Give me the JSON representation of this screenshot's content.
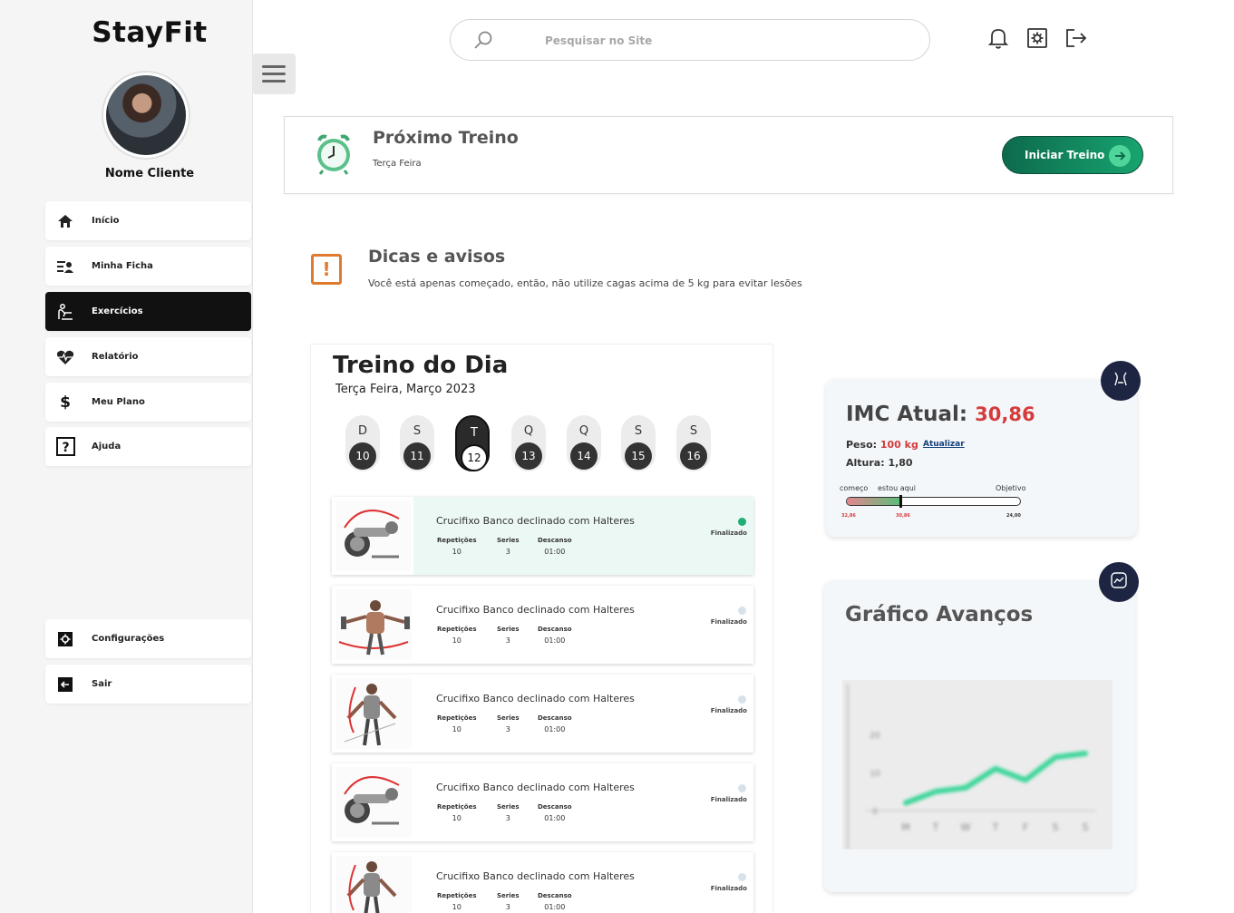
{
  "brand": "StayFit",
  "client_name": "Nome Cliente",
  "sidebar": {
    "items": [
      {
        "label": "Início",
        "icon": "home-icon"
      },
      {
        "label": "Minha Ficha",
        "icon": "profile-list-icon"
      },
      {
        "label": "Exercícios",
        "icon": "exercise-icon",
        "active": true
      },
      {
        "label": "Relatório",
        "icon": "heart-pulse-icon"
      },
      {
        "label": "Meu Plano",
        "icon": "dollar-icon"
      },
      {
        "label": "Ajuda",
        "icon": "help-icon"
      }
    ],
    "bottom_items": [
      {
        "label": "Configurações",
        "icon": "settings-icon"
      },
      {
        "label": "Sair",
        "icon": "logout-icon"
      }
    ]
  },
  "search": {
    "placeholder": "Pesquisar no Site"
  },
  "next_workout": {
    "title": "Próximo Treino",
    "day": "Terça Feira",
    "button": "Iniciar Treino"
  },
  "tips": {
    "title": "Dicas e avisos",
    "text": "Você está apenas começado, então, não utilize cagas acima de 5 kg para evitar lesões"
  },
  "workout": {
    "title": "Treino do Dia",
    "date": "Terça Feira, Março 2023",
    "days": [
      {
        "letter": "D",
        "num": "10"
      },
      {
        "letter": "S",
        "num": "11"
      },
      {
        "letter": "T",
        "num": "12",
        "selected": true
      },
      {
        "letter": "Q",
        "num": "13"
      },
      {
        "letter": "Q",
        "num": "14"
      },
      {
        "letter": "S",
        "num": "15"
      },
      {
        "letter": "S",
        "num": "16"
      }
    ],
    "headers": {
      "reps": "Repetições",
      "series": "Series",
      "rest": "Descanso"
    },
    "exercises": [
      {
        "name": "Crucifixo Banco declinado com Halteres",
        "reps": "10",
        "series": "3",
        "rest": "01:00",
        "status": "Finalizado",
        "done": true
      },
      {
        "name": "Crucifixo Banco declinado com Halteres",
        "reps": "10",
        "series": "3",
        "rest": "01:00",
        "status": "Finalizado",
        "done": false
      },
      {
        "name": "Crucifixo Banco declinado com Halteres",
        "reps": "10",
        "series": "3",
        "rest": "01:00",
        "status": "Finalizado",
        "done": false
      },
      {
        "name": "Crucifixo Banco declinado com Halteres",
        "reps": "10",
        "series": "3",
        "rest": "01:00",
        "status": "Finalizado",
        "done": false
      },
      {
        "name": "Crucifixo Banco declinado com Halteres",
        "reps": "10",
        "series": "3",
        "rest": "01:00",
        "status": "Finalizado",
        "done": false
      }
    ]
  },
  "imc": {
    "label": "IMC Atual:",
    "value": "30,86",
    "peso_label": "Peso:",
    "peso_value": "100 kg",
    "update": "Atualizar",
    "altura": "Altura: 1,80",
    "bar_labels": {
      "start": "começo",
      "current": "estou aqui",
      "goal": "Objetivo"
    },
    "bar_values": {
      "start": "32,86",
      "current": "30,86",
      "goal": "24,00"
    },
    "progress": 0.31
  },
  "graph": {
    "title": "Gráfico Avanços",
    "y_ticks": [
      "20",
      "10",
      "0"
    ],
    "x_labels": [
      "M",
      "T",
      "W",
      "T",
      "F",
      "S",
      "S"
    ],
    "values": [
      2,
      5,
      6,
      11,
      8,
      14,
      15
    ]
  },
  "colors": {
    "accent": "#17a46f",
    "danger": "#d53b3b",
    "dark": "#111111",
    "navy": "#1d2542"
  }
}
